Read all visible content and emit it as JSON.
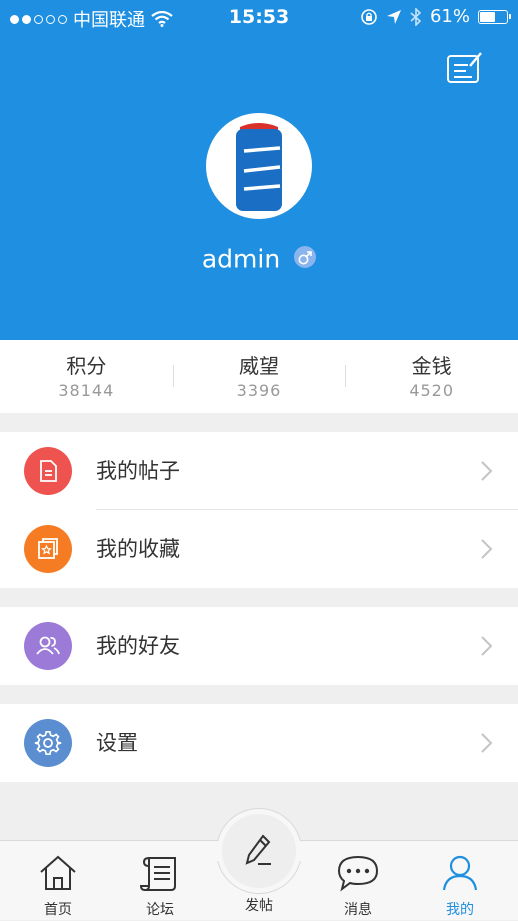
{
  "status_bar": {
    "carrier": "中国联通",
    "time": "15:53",
    "battery": "61%",
    "battery_level": 0.61
  },
  "profile": {
    "username": "admin",
    "gender_symbol": "♂"
  },
  "stats": [
    {
      "label": "积分",
      "value": "38144"
    },
    {
      "label": "威望",
      "value": "3396"
    },
    {
      "label": "金钱",
      "value": "4520"
    }
  ],
  "menu": {
    "my_posts": "我的帖子",
    "my_favorites": "我的收藏",
    "my_friends": "我的好友",
    "settings": "设置"
  },
  "tabbar": {
    "home": "首页",
    "forum": "论坛",
    "post": "发帖",
    "messages": "消息",
    "mine": "我的"
  },
  "colors": {
    "header_bg": "#1e8fe1",
    "posts_icon": "#ef5350",
    "favorites_icon": "#f57c23",
    "friends_icon": "#9c7bd8",
    "settings_icon": "#5b8ed0",
    "active_tab": "#1e8fe1"
  }
}
